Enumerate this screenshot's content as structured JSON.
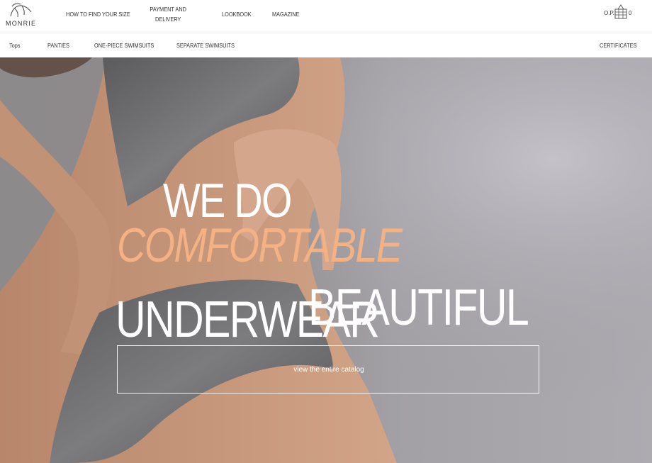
{
  "brand": {
    "logo_text": "MONRIE"
  },
  "nav": {
    "find_size": "HOW TO FIND YOUR SIZE",
    "payment_line1": "PAYMENT AND",
    "payment_line2": "DELIVERY",
    "lookbook": "LOOKBOOK",
    "magazine": "MAGAZINE"
  },
  "cart": {
    "label": "O.P.",
    "count": "0",
    "icon": "basket-icon"
  },
  "categories": {
    "items": [
      "Tops",
      "PANTIES",
      "ONE-PIECE SWIMSUITS",
      "SEPARATE SWIMSUITS"
    ],
    "certificates": "CERTIFICATES"
  },
  "hero": {
    "line1": "WE DO",
    "line2": "COMFORTABLE",
    "line3": "UNDERWEAR",
    "line4": "BEAUTIFUL",
    "cta": "view the entire catalog",
    "accent_color": "#f4b284"
  }
}
